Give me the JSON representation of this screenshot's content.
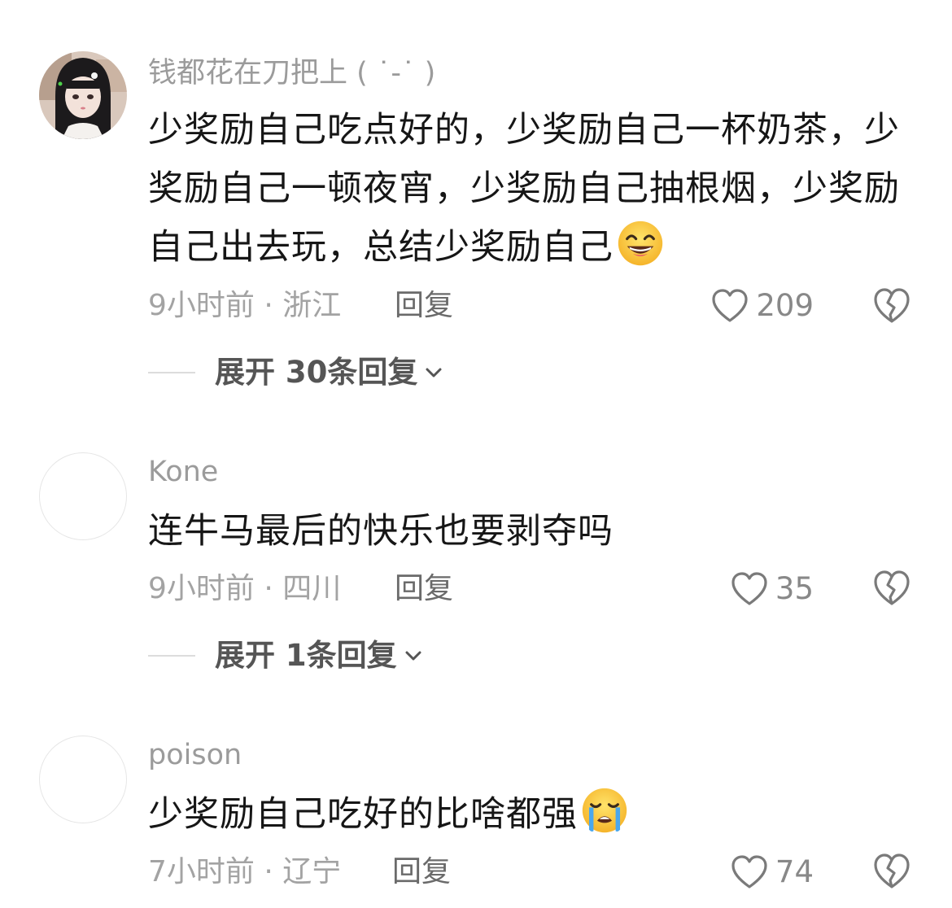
{
  "comments": [
    {
      "username": "钱都花在刀把上 ( ˙-˙ )",
      "text": "少奖励自己吃点好的，少奖励自己一杯奶茶，少奖励自己一顿夜宵，少奖励自己抽根烟，少奖励自己出去玩，总结少奖励自己",
      "emoji": "grinning-sweat-emoji",
      "time": "9小时前",
      "location": "浙江",
      "reply_label": "回复",
      "likes": "209",
      "expand_label": "展开 30条回复"
    },
    {
      "username": "Kone",
      "text": "连牛马最后的快乐也要剥夺吗",
      "time": "9小时前",
      "location": "四川",
      "reply_label": "回复",
      "likes": "35",
      "expand_label": "展开 1条回复"
    },
    {
      "username": "poison",
      "text": "少奖励自己吃好的比啥都强",
      "emoji": "loudly-crying-emoji",
      "time": "7小时前",
      "location": "辽宁",
      "reply_label": "回复",
      "likes": "74"
    }
  ],
  "separator": " · "
}
